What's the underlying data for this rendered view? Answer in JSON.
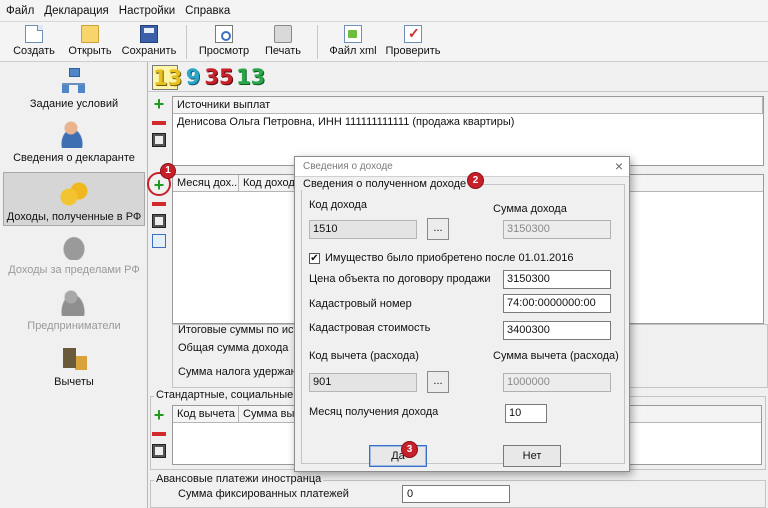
{
  "menu": [
    "Файл",
    "Декларация",
    "Настройки",
    "Справка"
  ],
  "toolbar": {
    "create": "Создать",
    "open": "Открыть",
    "save": "Сохранить",
    "preview": "Просмотр",
    "print": "Печать",
    "xml": "Файл xml",
    "check": "Проверить"
  },
  "sidebar": {
    "items": [
      {
        "label": "Задание условий",
        "icon": "org-chart-icon"
      },
      {
        "label": "Сведения о декларанте",
        "icon": "person-icon"
      },
      {
        "label": "Доходы, полученные в РФ",
        "icon": "coins-icon",
        "active": true
      },
      {
        "label": "Доходы за пределами РФ",
        "icon": "money-bag-icon",
        "disabled": true
      },
      {
        "label": "Предприниматели",
        "icon": "businessman-icon",
        "disabled": true
      },
      {
        "label": "Вычеты",
        "icon": "calculator-icon"
      }
    ]
  },
  "rates": [
    {
      "label": "13",
      "color": "#e8c020"
    },
    {
      "label": "9",
      "color": "#2aa6c8"
    },
    {
      "label": "35",
      "color": "#c8202a"
    },
    {
      "label": "13",
      "color": "#2aa64a"
    }
  ],
  "sources": {
    "header": "Источники выплат",
    "rows": [
      "Денисова Ольга Петровна, ИНН 111111111111 (продажа квартиры)"
    ]
  },
  "incomes": {
    "headers": [
      "Месяц дох...",
      "Код дохода"
    ]
  },
  "totals": {
    "label": "Итоговые суммы по ист",
    "total_income": "Общая сумма дохода",
    "tax_withheld": "Сумма налога удержан"
  },
  "deductions": {
    "label": "Стандартные, социальные и",
    "headers": [
      "Код вычета",
      "Сумма вы"
    ]
  },
  "advance": {
    "label": "Авансовые платежи иностранца",
    "fixed_label": "Сумма фиксированных платежей",
    "fixed_value": "0"
  },
  "markers": [
    "1",
    "2",
    "3"
  ],
  "dialog": {
    "title": "Сведения о доходе",
    "group": "Сведения о полученном доходе",
    "income_code_label": "Код дохода",
    "income_code": "1510",
    "income_sum_label": "Сумма дохода",
    "income_sum": "3150300",
    "acquired_after": "Имущество было приобретено после 01.01.2016",
    "acquired_checked": "✔",
    "contract_price_label": "Цена объекта по договору продажи",
    "contract_price": "3150300",
    "cadastral_number_label": "Кадастровый номер",
    "cadastral_number": "74:00:0000000:00",
    "cadastral_value_label": "Кадастровая стоимость",
    "cadastral_value": "3400300",
    "deduction_code_label": "Код вычета (расхода)",
    "deduction_code": "901",
    "deduction_sum_label": "Сумма вычета (расхода)",
    "deduction_sum": "1000000",
    "month_label": "Месяц получения дохода",
    "month": "10",
    "browse": "...",
    "yes": "Да",
    "no": "Нет",
    "close": "×"
  }
}
